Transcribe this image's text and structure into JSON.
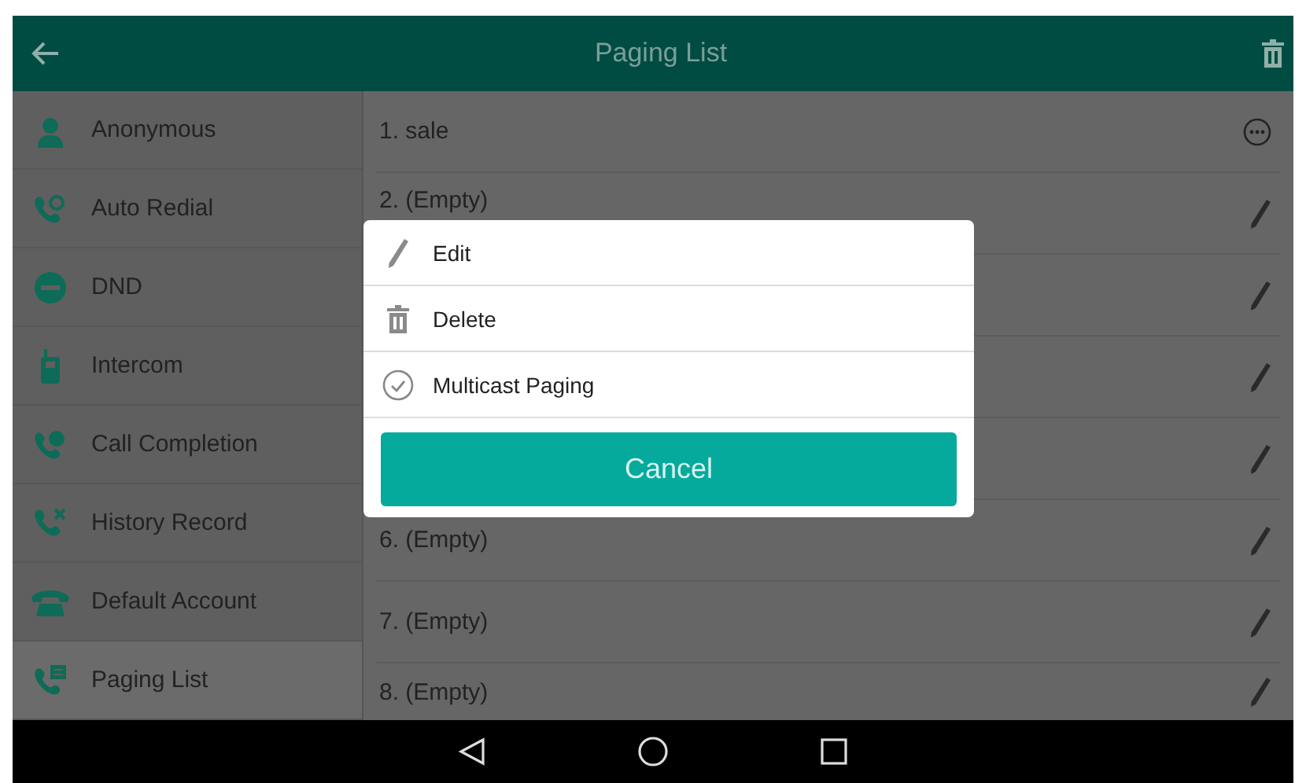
{
  "header": {
    "title": "Paging List"
  },
  "sidebar": {
    "items": [
      {
        "label": "Anonymous",
        "selected": false
      },
      {
        "label": "Auto Redial",
        "selected": false
      },
      {
        "label": "DND",
        "selected": false
      },
      {
        "label": "Intercom",
        "selected": false
      },
      {
        "label": "Call Completion",
        "selected": false
      },
      {
        "label": "History Record",
        "selected": false
      },
      {
        "label": "Default Account",
        "selected": false
      },
      {
        "label": "Paging List",
        "selected": true
      }
    ]
  },
  "paging_list": {
    "rows": [
      {
        "label": "1. sale",
        "kind": "more"
      },
      {
        "label": "2. (Empty)",
        "kind": "edit"
      },
      {
        "kind": "edit"
      },
      {
        "kind": "edit"
      },
      {
        "kind": "edit"
      },
      {
        "label": "6. (Empty)",
        "kind": "edit"
      },
      {
        "label": "7. (Empty)",
        "kind": "edit"
      },
      {
        "label": "8. (Empty)",
        "kind": "edit"
      }
    ]
  },
  "dialog": {
    "options": [
      {
        "label": "Edit",
        "kind": "edit"
      },
      {
        "label": "Delete",
        "kind": "delete"
      },
      {
        "label": "Multicast Paging",
        "kind": "multicast"
      }
    ],
    "cancel_button": "Cancel"
  }
}
